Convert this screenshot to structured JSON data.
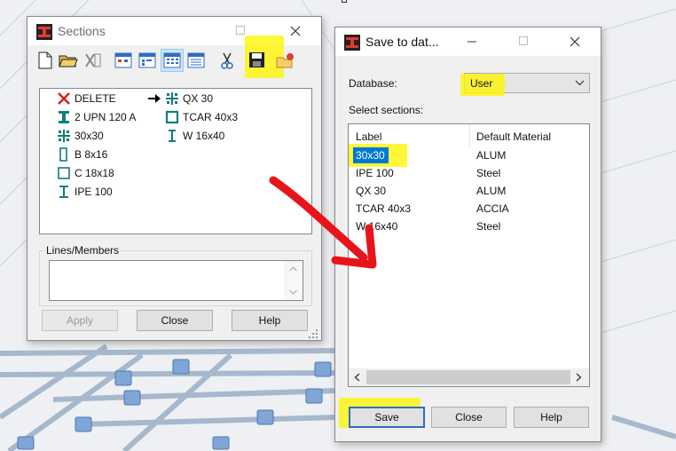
{
  "sections_window": {
    "title": "Sections",
    "toolbar_icons": [
      "new-icon",
      "open-folder-icon",
      "delete-x-icon",
      "view-icon-1",
      "view-icon-2",
      "view-icon-3",
      "view-icon-4",
      "cut-scissors-icon",
      "save-disk-icon",
      "export-icon"
    ],
    "items_col1": [
      {
        "label": "DELETE",
        "icon": "red-x-icon"
      },
      {
        "label": "2 UPN 120 A",
        "icon": "i-beam-icon"
      },
      {
        "label": "30x30",
        "icon": "cross-section-icon"
      },
      {
        "label": "B 8x16",
        "icon": "rect-section-icon"
      },
      {
        "label": "C 18x18",
        "icon": "square-section-icon"
      },
      {
        "label": "IPE 100",
        "icon": "i-beam-thin-icon"
      }
    ],
    "items_col2": [
      {
        "label": "QX 30",
        "icon": "arrow-cross-icon"
      },
      {
        "label": "TCAR 40x3",
        "icon": "square-tube-icon"
      },
      {
        "label": "W 16x40",
        "icon": "w-beam-icon"
      }
    ],
    "lines_members_label": "Lines/Members",
    "apply_label": "Apply",
    "close_label": "Close",
    "help_label": "Help"
  },
  "save_dialog": {
    "title": "Save to dat...",
    "database_label": "Database:",
    "database_value": "User",
    "select_label": "Select sections:",
    "col_label": "Label",
    "col_material": "Default Material",
    "rows": [
      {
        "label": "30x30",
        "material": "ALUM",
        "selected": true
      },
      {
        "label": "IPE 100",
        "material": "Steel",
        "selected": false
      },
      {
        "label": "QX 30",
        "material": "ALUM",
        "selected": false
      },
      {
        "label": "TCAR 40x3",
        "material": "ACCIA",
        "selected": false
      },
      {
        "label": "W 16x40",
        "material": "Steel",
        "selected": false
      }
    ],
    "save_label": "Save",
    "close_label": "Close",
    "help_label": "Help"
  },
  "colors": {
    "accent": "#2f6dc5",
    "highlight": "#fff200",
    "annotation_arrow": "#e8141b",
    "section_icon": "#0f7d80",
    "selection": "#0078d7"
  }
}
